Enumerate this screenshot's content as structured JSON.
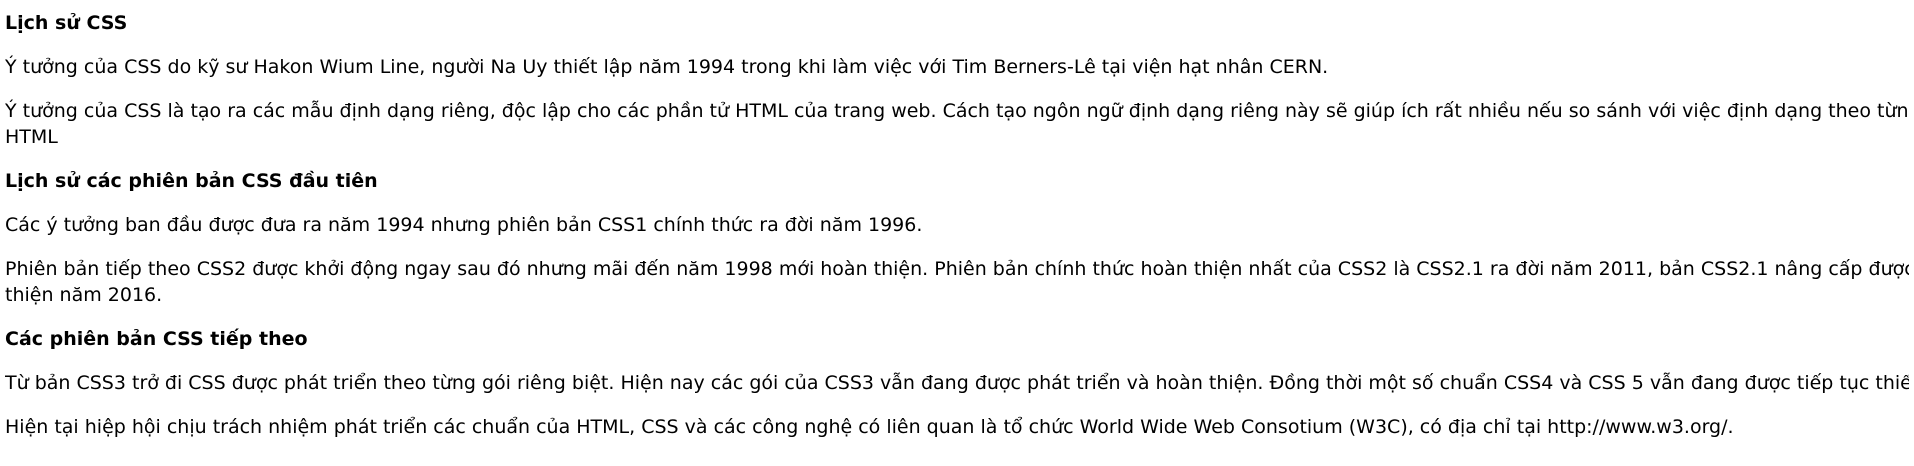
{
  "sections": [
    {
      "heading": "Lịch sử CSS",
      "paragraphs": [
        "Ý tưởng của CSS do kỹ sư Hakon Wium Line, người Na Uy thiết lập năm 1994 trong khi làm việc với Tim Berners-Lê tại viện hạt nhân CERN.",
        {
          "line1": "Ý tưởng của CSS là tạo ra các mẫu định dạng riêng, độc lập cho các phần tử HTML của trang web. Cách tạo ngôn ngữ định dạng riêng này sẽ giúp ích rất nhiều nếu so sánh với việc định dạng theo từng thẻ",
          "line2": "HTML"
        }
      ]
    },
    {
      "heading": "Lịch sử các phiên bản CSS đầu tiên",
      "paragraphs": [
        "Các ý tưởng ban đầu được đưa ra năm 1994 nhưng phiên bản CSS1 chính thức ra đời năm 1996.",
        {
          "line1": "Phiên bản tiếp theo CSS2 được khởi động ngay sau đó nhưng mãi đến năm 1998 mới hoàn thiện. Phiên bản chính thức hoàn thiện nhất của CSS2 là CSS2.1 ra đời năm 2011, bản CSS2.1 nâng cấp được hoàn",
          "line2": "thiện năm 2016."
        }
      ]
    },
    {
      "heading": "Các phiên bản CSS tiếp theo",
      "paragraphs": [
        "Từ bản CSS3 trở đi CSS được phát triển theo từng gói riêng biệt. Hiện nay các gói của CSS3 vẫn đang được phát triển và hoàn thiện. Đồng thời một số chuẩn CSS4 và CSS 5 vẫn đang được tiếp tục thiết lập mới.",
        "Hiện tại hiệp hội chịu trách nhiệm phát triển các chuẩn của HTML, CSS và các công nghệ có liên quan là tổ chức World Wide Web Consotium (W3C), có địa chỉ tại http://www.w3.org/."
      ]
    }
  ]
}
